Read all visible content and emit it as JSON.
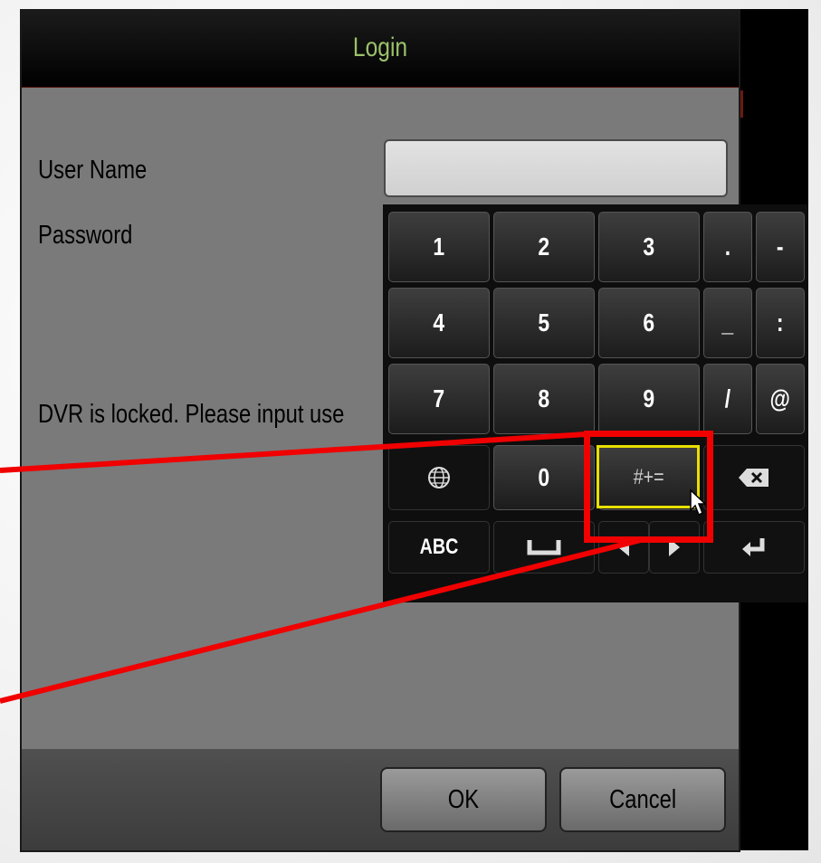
{
  "dialog": {
    "title": "Login",
    "username_label": "User Name",
    "username_value": "",
    "password_label": "Password",
    "message": "DVR is locked. Please input use",
    "ok_label": "OK",
    "cancel_label": "Cancel"
  },
  "keyboard": {
    "row1": [
      "1",
      "2",
      "3",
      ".",
      "-"
    ],
    "row2": [
      "4",
      "5",
      "6",
      "_",
      ":"
    ],
    "row3": [
      "7",
      "8",
      "9",
      "/",
      "@"
    ],
    "row4": {
      "globe_icon": "globe-icon",
      "zero": "0",
      "symbols": "#+=",
      "backspace_icon": "backspace-icon"
    },
    "row5": {
      "abc": "ABC",
      "space_icon": "space-icon",
      "left_icon": "arrow-left-icon",
      "right_icon": "arrow-right-icon",
      "enter_icon": "enter-icon"
    }
  },
  "annotation": {
    "color": "#f00000",
    "highlight_color": "#e8e000"
  }
}
